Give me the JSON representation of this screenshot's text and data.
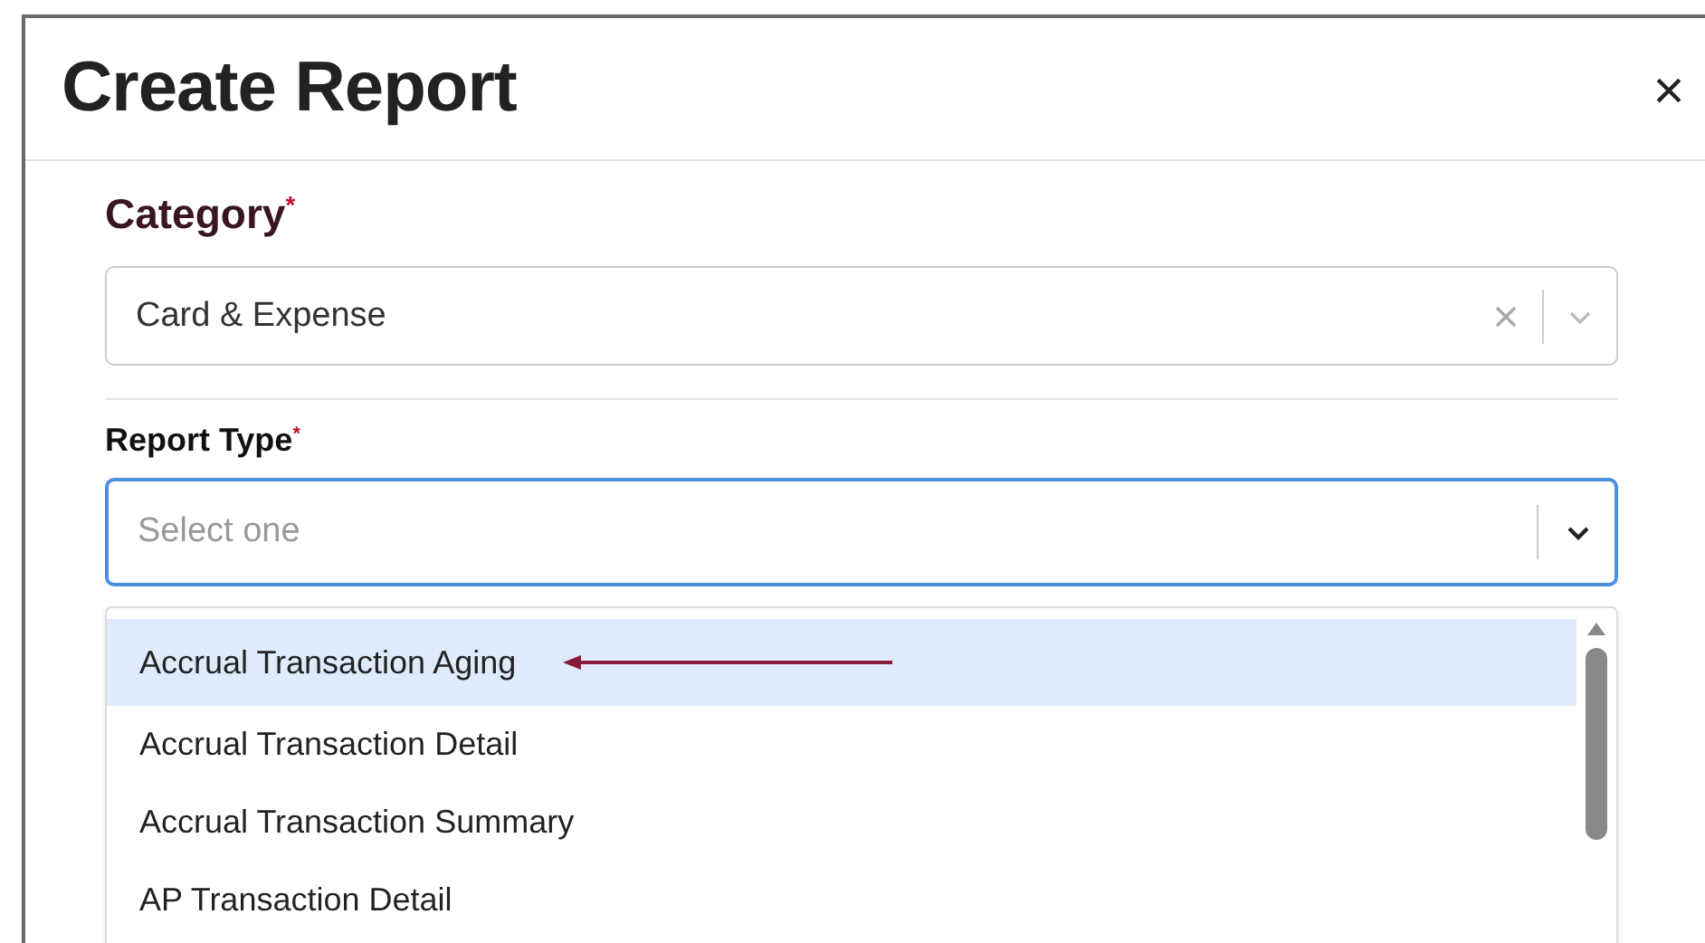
{
  "dialog": {
    "title": "Create Report",
    "close": "×"
  },
  "category": {
    "label": "Category",
    "required": true,
    "required_mark": "*",
    "value": "Card & Expense"
  },
  "report_type": {
    "label": "Report Type",
    "required": true,
    "required_mark": "*",
    "placeholder": "Select one",
    "focused": true,
    "expanded": true,
    "options": [
      {
        "label": "Accrual Transaction Aging",
        "selected": true
      },
      {
        "label": "Accrual Transaction Detail",
        "selected": false
      },
      {
        "label": "Accrual Transaction Summary",
        "selected": false
      },
      {
        "label": "AP Transaction Detail",
        "selected": false
      }
    ]
  }
}
